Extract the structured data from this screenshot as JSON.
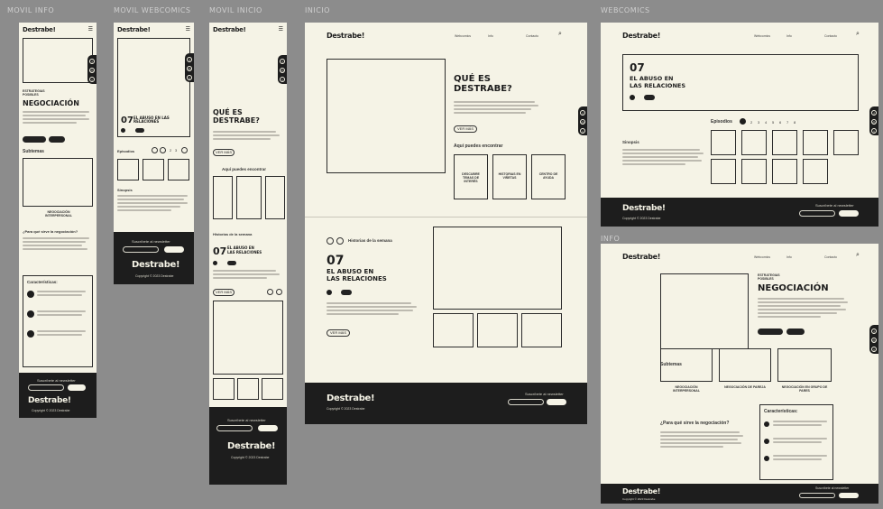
{
  "artboards": {
    "movil_info": "MOVIL INFO",
    "movil_webcomics": "MOVIL WEBCOMICS",
    "movil_inicio": "MOVIL INICIO",
    "inicio": "INICIO",
    "webcomics": "WEBCOMICS",
    "info": "INFO"
  },
  "brand": {
    "logo": "Destrabe!"
  },
  "nav": {
    "item1": "Webcomics",
    "item2": "Info",
    "item3": "Contacto"
  },
  "info": {
    "tag": "ESTRATEGIAS POSIBLES",
    "title": "NEGOCIACIÓN",
    "subtopics": "Subtemas",
    "card1": "NEGOCIACIÓN INTERPERSONAL",
    "card2": "NEGOCIACIÓN DE PAREJA",
    "card3": "NEGOCIACIÓN EN GRUPO DE PARES",
    "why": "¿Para qué sirve la negociación?",
    "features": "Características:"
  },
  "comic": {
    "number": "07",
    "title": "EL ABUSO EN LAS RELACIONES",
    "title_line1": "EL ABUSO EN",
    "title_line2": "LAS RELACIONES",
    "episodes": "Episodios",
    "episode_numbers": [
      "1",
      "2",
      "3",
      "4",
      "5",
      "6",
      "7",
      "8"
    ],
    "synopsis": "Sinopsis",
    "history": "Historias de la semana",
    "see_more": "VER MÁS"
  },
  "home": {
    "what_is": "QUÉ ES DESTRABE?",
    "what_is_line1": "QUÉ ES",
    "what_is_line2": "DESTRABE?",
    "you_will_find": "Aquí puedes encontrar",
    "card1": "DESCUBRE TEMAS DE INTERÉS",
    "card2": "HISTORIAS EN VIÑETAS",
    "card3": "CENTRO DE AYUDA"
  },
  "footer": {
    "newsletter": "Suscríbete al newsletter",
    "input_placeholder": "Tu correo",
    "button": "Suscribir",
    "copyright": "Copyright © 2023 Destrabe"
  },
  "colors": {
    "paper": "#f5f3e6",
    "ink": "#1d1d1d",
    "canvas": "#8c8c8c"
  }
}
